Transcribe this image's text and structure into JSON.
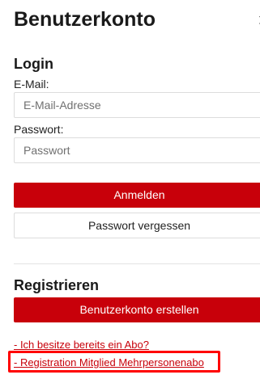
{
  "header": {
    "title": "Benutzerkonto",
    "close_icon": "chevron-right-icon",
    "close_glyph": "›"
  },
  "login": {
    "heading": "Login",
    "email_label": "E-Mail:",
    "email_placeholder": "E-Mail-Adresse",
    "email_value": "",
    "password_label": "Passwort:",
    "password_placeholder": "Passwort",
    "password_value": "",
    "submit_label": "Anmelden",
    "forgot_label": "Passwort vergessen"
  },
  "register": {
    "heading": "Registrieren",
    "create_label": "Benutzerkonto erstellen",
    "links": [
      "- Ich besitze bereits ein Abo?",
      "- Registration Mitglied Mehrpersonenabo"
    ],
    "highlighted_link_index": 1
  },
  "colors": {
    "accent": "#c8000a",
    "highlight": "#ff0000",
    "border": "#dcdcdc"
  }
}
